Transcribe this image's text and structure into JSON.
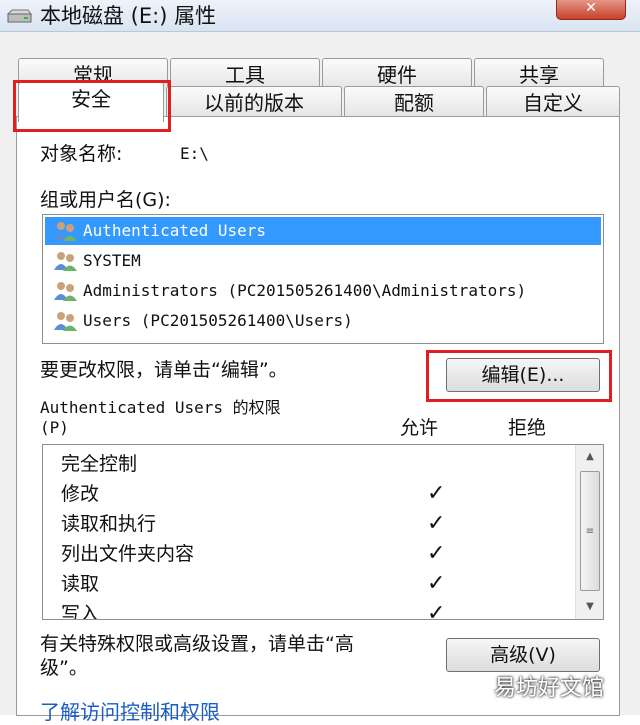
{
  "window": {
    "title": "本地磁盘 (E:) 属性",
    "close_label": "✕"
  },
  "tabs": {
    "row1": [
      "常规",
      "工具",
      "硬件",
      "共享"
    ],
    "row2": [
      "安全",
      "以前的版本",
      "配额",
      "自定义"
    ],
    "active": "安全"
  },
  "object": {
    "label": "对象名称:",
    "value": "E:\\"
  },
  "groups": {
    "label": "组或用户名(G):",
    "users": [
      {
        "name": "Authenticated Users",
        "selected": true
      },
      {
        "name": "SYSTEM",
        "selected": false
      },
      {
        "name": "Administrators (PC201505261400\\Administrators)",
        "selected": false
      },
      {
        "name": "Users (PC201505261400\\Users)",
        "selected": false
      }
    ]
  },
  "edit": {
    "hint": "要更改权限，请单击“编辑”。",
    "button_label": "编辑(E)..."
  },
  "permissions": {
    "title_line1": "Authenticated Users 的权限",
    "title_line2": "(P)",
    "allow_header": "允许",
    "deny_header": "拒绝",
    "rows": [
      {
        "name": "完全控制",
        "allow": ""
      },
      {
        "name": "修改",
        "allow": "✓"
      },
      {
        "name": "读取和执行",
        "allow": "✓"
      },
      {
        "name": "列出文件夹内容",
        "allow": "✓"
      },
      {
        "name": "读取",
        "allow": "✓"
      },
      {
        "name": "写入",
        "allow": "✓"
      }
    ]
  },
  "advanced": {
    "hint_line1": "有关特殊权限或高级设置，请单击“高",
    "hint_line2": "级”。",
    "button_label": "高级(V)"
  },
  "link": "了解访问控制和权限",
  "watermark": "易坊好文馆",
  "colors": {
    "selection": "#3399ff",
    "highlight_box": "#e02020",
    "link": "#1a5dc6"
  }
}
